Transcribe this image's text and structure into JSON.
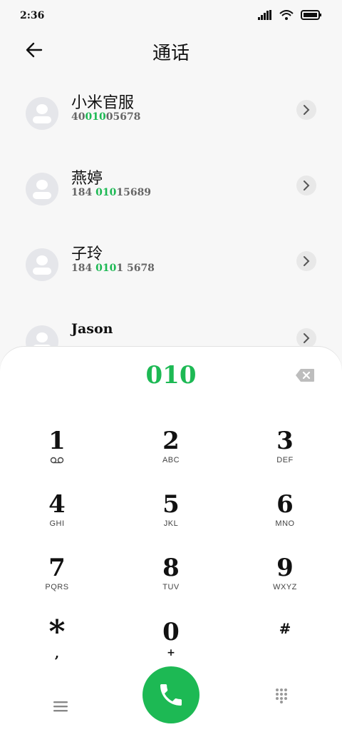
{
  "status_bar": {
    "time": "2:36"
  },
  "header": {
    "title": "通话"
  },
  "contacts": [
    {
      "name": "小米官服",
      "num_pre": "40",
      "num_hl": "010",
      "num_post": "05678"
    },
    {
      "name": "燕婷",
      "num_pre": "184 ",
      "num_hl": "010",
      "num_post": "15689"
    },
    {
      "name": "子玲",
      "num_pre": "184 ",
      "num_hl": "010",
      "num_post": "1 5678"
    },
    {
      "name": "Jason",
      "num_pre": "",
      "num_hl": "",
      "num_post": ""
    }
  ],
  "dialer": {
    "dialed": "010",
    "keys": [
      {
        "digit": "1",
        "letters": ""
      },
      {
        "digit": "2",
        "letters": "ABC"
      },
      {
        "digit": "3",
        "letters": "DEF"
      },
      {
        "digit": "4",
        "letters": "GHI"
      },
      {
        "digit": "5",
        "letters": "JKL"
      },
      {
        "digit": "6",
        "letters": "MNO"
      },
      {
        "digit": "7",
        "letters": "PQRS"
      },
      {
        "digit": "8",
        "letters": "TUV"
      },
      {
        "digit": "9",
        "letters": "WXYZ"
      },
      {
        "digit": "*",
        "letters": ","
      },
      {
        "digit": "0",
        "letters": "+"
      },
      {
        "digit": "#",
        "letters": ""
      }
    ]
  },
  "colors": {
    "accent": "#1db954",
    "avatar_bg": "#e5e6ea",
    "panel_bg": "#ffffff"
  },
  "icons": {
    "back": "arrow-left-icon",
    "backspace": "backspace-icon",
    "voicemail": "voicemail-icon",
    "menu": "menu-icon",
    "call": "phone-icon",
    "keypad": "keypad-icon"
  }
}
